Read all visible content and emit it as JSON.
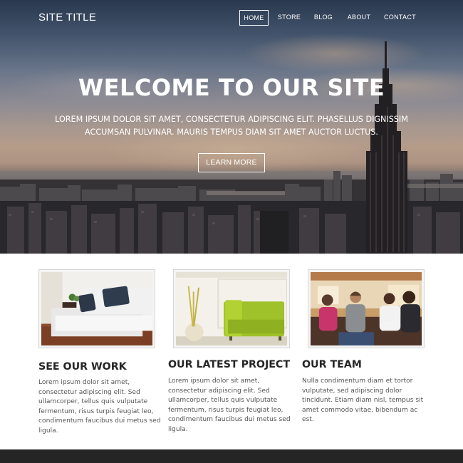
{
  "header": {
    "site_title": "SITE TITLE",
    "nav": [
      {
        "label": "HOME",
        "active": true
      },
      {
        "label": "STORE",
        "active": false
      },
      {
        "label": "BLOG",
        "active": false
      },
      {
        "label": "ABOUT",
        "active": false
      },
      {
        "label": "CONTACT",
        "active": false
      }
    ]
  },
  "hero": {
    "heading": "WELCOME TO OUR SITE",
    "subtext": "LOREM IPSUM DOLOR SIT AMET, CONSECTETUR ADIPISCING ELIT. PHASELLUS DIGNISSIM ACCUMSAN PULVINAR. MAURIS TEMPUS DIAM SIT AMET AUCTOR LUCTUS.",
    "button_label": "LEARN MORE"
  },
  "features": [
    {
      "heading": "SEE OUR WORK",
      "image": "living-room-sofa-photo",
      "body": "Lorem ipsum dolor sit amet, consectetur adipiscing elit. Sed ullamcorper, tellus quis vulputate fermentum, risus turpis feugiat leo, condimentum faucibus dui metus sed ligula."
    },
    {
      "heading": "OUR LATEST PROJECT",
      "image": "green-armchair-photo",
      "body": "Lorem ipsum dolor sit amet, consectetur adipiscing elit. Sed ullamcorper, tellus quis vulputate fermentum, risus turpis feugiat leo, condimentum faucibus dui metus sed ligula."
    },
    {
      "heading": "OUR TEAM",
      "image": "team-group-photo",
      "body": "Nulla condimentum diam et tortor vulputate, sed adipiscing dolor tincidunt. Etiam diam nisl, tempus sit amet commodo vitae, bibendum ac est."
    }
  ],
  "colors": {
    "footer": "#252525",
    "heading_text": "#262626",
    "body_text": "#555555"
  }
}
